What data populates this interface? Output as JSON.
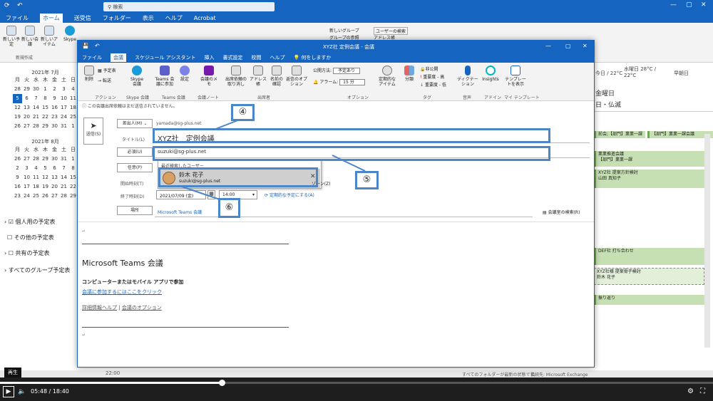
{
  "outlook_bg": {
    "search_placeholder": "検索",
    "tabs": [
      "ファイル",
      "ホーム",
      "送受信",
      "フォルダー",
      "表示",
      "ヘルプ",
      "Acrobat"
    ],
    "selected_tab": "ホーム",
    "ribbon_items": [
      "新しい予定",
      "新しい会議",
      "新しいアイテム",
      "Skype",
      "新しいグループ",
      "グループの参照",
      "ユーザーの検索",
      "アドレス帳"
    ],
    "ribbon_group": "新規作成",
    "cal_july_title": "2021年 7月",
    "cal_aug_title": "2021年 8月",
    "weekdays": [
      "月",
      "火",
      "水",
      "木",
      "金",
      "土",
      "日"
    ],
    "july_days": [
      "28",
      "29",
      "30",
      "1",
      "2",
      "3",
      "4",
      "5",
      "6",
      "7",
      "8",
      "9",
      "10",
      "11",
      "12",
      "13",
      "14",
      "15",
      "16",
      "17",
      "18",
      "19",
      "20",
      "21",
      "22",
      "23",
      "24",
      "25",
      "26",
      "27",
      "28",
      "29",
      "30",
      "31",
      "1"
    ],
    "aug_days": [
      "26",
      "27",
      "28",
      "29",
      "30",
      "31",
      "1",
      "2",
      "3",
      "4",
      "5",
      "6",
      "7",
      "8",
      "9",
      "10",
      "11",
      "12",
      "13",
      "14",
      "15",
      "16",
      "17",
      "18",
      "19",
      "20",
      "21",
      "22",
      "23",
      "24",
      "25",
      "26",
      "27",
      "28",
      "29"
    ],
    "today": "5",
    "folders": [
      "個人用の予定表",
      "その他の予定表",
      "共有の予定表",
      "すべてのグループ予定表"
    ],
    "weather1": "今日 / 22°C",
    "weather2": "水曜日 28°C / 22°C",
    "weather3": "早朝日",
    "day_label": "金曜日",
    "day_sub": "日・仏滅",
    "events": [
      "前会;【部門】業業一課",
      "【部門】業業一課会議",
      "業業推進会議",
      "【部門】業業一課",
      "XYZ社 提案方針検討",
      "山田 真知子",
      "DEF社 打ち合わせ",
      "XYZ社様 提案骨子検討",
      "鈴木 花子",
      "振り返り"
    ],
    "time_label": "22:00",
    "status_text": "すべてのフォルダーが最新の状態です。",
    "status_conn": "接続先: Microsoft Exchange"
  },
  "dialog": {
    "title": "XYZ社 定例会議 - 会議",
    "tabs": [
      "ファイル",
      "会議",
      "スケジュール アシスタント",
      "挿入",
      "書式設定",
      "校閲",
      "ヘルプ",
      "何をしますか"
    ],
    "selected_tab": "会議",
    "ribbon": {
      "delete": "削除",
      "calendar": "予定表",
      "forward": "転送",
      "skype": "Skype 会議",
      "teams": "Teams 会議に参加",
      "settings": "設定",
      "onenote": "会議のメモ",
      "cancel_response": "出席依頼の取り消し",
      "address_book": "アドレス帳",
      "check_names": "名前の確認",
      "response_options": "返信のオプション",
      "show_as_label": "公開方法:",
      "show_as_value": "予定あり",
      "reminder_label": "アラーム:",
      "reminder_value": "15 分",
      "recurrence": "定期的なアイテム",
      "categorize": "分類",
      "private": "非公開",
      "high": "重要度 - 高",
      "low": "重要度 - 低",
      "dictate": "ディクテーション",
      "insights": "Insights",
      "templates": "テンプレートを表示",
      "groups": [
        "アクション",
        "Skype 会議",
        "Teams 会議",
        "会議ノート",
        "出席者",
        "オプション",
        "タグ",
        "音声",
        "アドイン",
        "マイ テンプレート"
      ]
    },
    "info": "この会議出席依頼はまだ送信されていません。",
    "send": "送信(S)",
    "from_btn": "差出人(M)",
    "from_value": "yamada@sg-plus.net",
    "title_label": "タイトル(L)",
    "title_value": "XYZ社　定例会議",
    "required_btn": "必須(U)",
    "required_value": "suzuki@sg-plus.net",
    "optional_btn": "任意(P)",
    "recent_label": "最近検索したユーザー",
    "suggest_name": "鈴木 花子",
    "suggest_email": "suzuki@sg-plus.net",
    "start_label": "開始時刻(T)",
    "end_label": "終了時刻(D)",
    "end_date": "2021/07/09 (金)",
    "end_time": "14:00",
    "timezone": "ゾーン(Z)",
    "recurring": "定期的な予定にする(A)",
    "location_btn": "場所",
    "location_value": "Microsoft Teams 会議",
    "room_finder": "会議室の検索(R)",
    "body_heading": "Microsoft Teams 会議",
    "body_join_title": "コンピューターまたはモバイル アプリで参加",
    "body_join_link": "会議に参加するにはここをクリック",
    "body_help": "詳細情報ヘルプ",
    "body_sep": "|",
    "body_options": "会議のオプション"
  },
  "callouts": [
    "④",
    "⑤",
    "⑥"
  ],
  "video": {
    "tooltip": "再生",
    "time": "05:48 / 18:40"
  }
}
